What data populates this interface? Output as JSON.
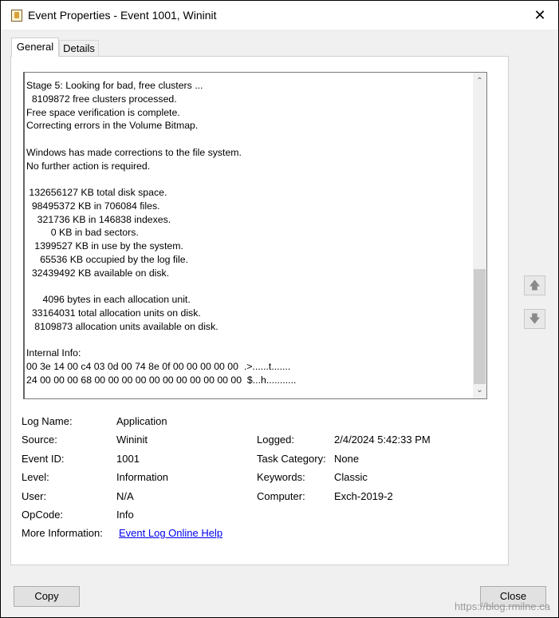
{
  "window": {
    "title": "Event Properties - Event 1001, Wininit",
    "close_glyph": "✕"
  },
  "tabs": [
    {
      "label": "General",
      "selected": true
    },
    {
      "label": "Details",
      "selected": false
    }
  ],
  "description": {
    "text": "Stage 5: Looking for bad, free clusters ...\n  8109872 free clusters processed.\nFree space verification is complete.\nCorrecting errors in the Volume Bitmap.\n\nWindows has made corrections to the file system.\nNo further action is required.\n\n 132656127 KB total disk space.\n  98495372 KB in 706084 files.\n    321736 KB in 146838 indexes.\n         0 KB in bad sectors.\n   1399527 KB in use by the system.\n     65536 KB occupied by the log file.\n  32439492 KB available on disk.\n\n      4096 bytes in each allocation unit.\n  33164031 total allocation units on disk.\n   8109873 allocation units available on disk.\n\nInternal Info:\n00 3e 14 00 c4 03 0d 00 74 8e 0f 00 00 00 00 00  .>......t.......\n24 00 00 00 68 00 00 00 00 00 00 00 00 00 00 00  $...h...........",
    "scroll_up_glyph": "⌃",
    "scroll_down_glyph": "⌄"
  },
  "nav": {
    "up_glyph": "🡅",
    "down_glyph": "🡇"
  },
  "fields": {
    "log_name": {
      "label": "Log Name:",
      "value": "Application"
    },
    "source": {
      "label": "Source:",
      "value": "Wininit"
    },
    "event_id": {
      "label": "Event ID:",
      "value": "1001"
    },
    "level": {
      "label": "Level:",
      "value": "Information"
    },
    "user": {
      "label": "User:",
      "value": "N/A"
    },
    "opcode": {
      "label": "OpCode:",
      "value": "Info"
    },
    "more_info": {
      "label": "More Information:",
      "value": "Event Log Online Help"
    },
    "logged": {
      "label": "Logged:",
      "value": "2/4/2024 5:42:33 PM"
    },
    "task_category": {
      "label": "Task Category:",
      "value": "None"
    },
    "keywords": {
      "label": "Keywords:",
      "value": "Classic"
    },
    "computer": {
      "label": "Computer:",
      "value": "Exch-2019-2"
    }
  },
  "buttons": {
    "copy": "Copy",
    "close": "Close"
  },
  "watermark": "https://blog.rmilne.ca"
}
